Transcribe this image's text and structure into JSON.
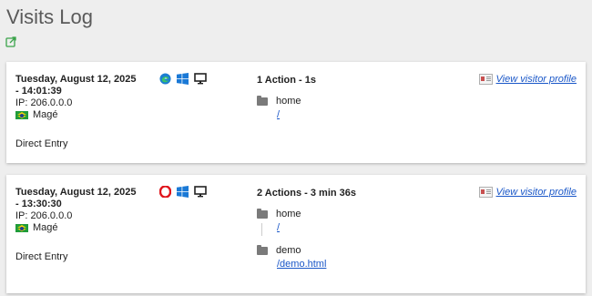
{
  "page": {
    "title": "Visits Log"
  },
  "visits": [
    {
      "date_line1": "Tuesday, August 12, 2025",
      "date_line2": "- 14:01:39",
      "ip": "IP: 206.0.0.0",
      "city": "Magé",
      "referrer": "Direct Entry",
      "browser": "Microsoft Edge",
      "os": "Windows",
      "device": "Desktop",
      "summary": "1 Action - 1s",
      "profile_link": "View visitor profile",
      "actions": [
        {
          "title": "home",
          "url": "/"
        }
      ]
    },
    {
      "date_line1": "Tuesday, August 12, 2025",
      "date_line2": "- 13:30:30",
      "ip": "IP: 206.0.0.0",
      "city": "Magé",
      "referrer": "Direct Entry",
      "browser": "Opera",
      "os": "Windows",
      "device": "Desktop",
      "summary": "2 Actions - 3 min 36s",
      "profile_link": "View visitor profile",
      "actions": [
        {
          "title": "home",
          "url": "/"
        },
        {
          "title": "demo",
          "url": "/demo.html"
        }
      ]
    }
  ],
  "icons": {
    "export": "export-icon",
    "folder": "folder-icon",
    "profile": "visitor-profile-icon",
    "flag": "brazil-flag-icon"
  },
  "colors": {
    "link": "#1a57c8",
    "background": "#eeeeee",
    "card": "#ffffff",
    "export_icon": "#3aa34a"
  }
}
